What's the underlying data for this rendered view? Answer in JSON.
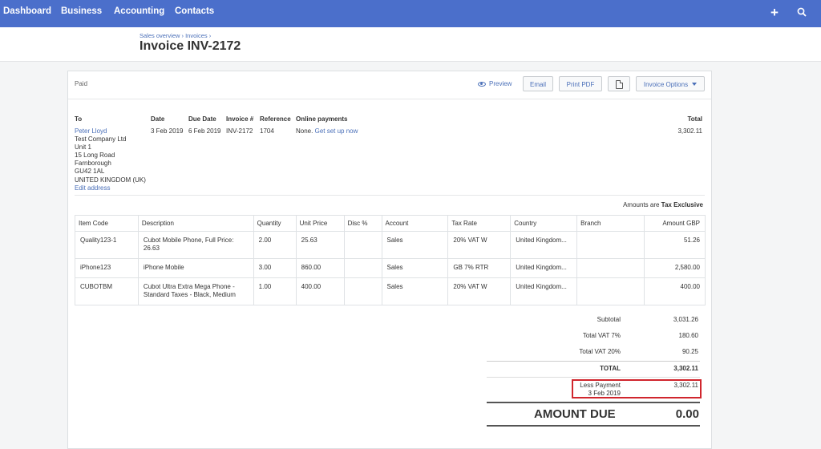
{
  "nav": {
    "items": [
      "Dashboard",
      "Business",
      "Accounting",
      "Contacts"
    ],
    "add_icon": "plus-icon",
    "search_icon": "search-icon"
  },
  "header": {
    "breadcrumb": "Sales overview › Invoices ›",
    "title": "Invoice INV-2172"
  },
  "toolbar": {
    "status": "Paid",
    "preview": "Preview",
    "email": "Email",
    "print_pdf": "Print PDF",
    "copy_icon": "copy-icon",
    "invoice_options": "Invoice Options"
  },
  "meta": {
    "to_label": "To",
    "date_label": "Date",
    "due_label": "Due Date",
    "invoice_label": "Invoice #",
    "reference_label": "Reference",
    "online_label": "Online payments",
    "total_label": "Total",
    "date": "3 Feb 2019",
    "due_date": "6 Feb 2019",
    "invoice_no": "INV-2172",
    "reference": "1704",
    "online_none": "None.",
    "online_link": "Get set up now",
    "total": "3,302.11"
  },
  "address": {
    "contact": "Peter Lloyd",
    "lines": [
      "Test Company Ltd",
      "Unit 1",
      "15 Long Road",
      "Farnborough",
      "GU42 1AL",
      "UNITED KINGDOM (UK)"
    ],
    "edit": "Edit address"
  },
  "amounts_note": {
    "prefix": "Amounts are",
    "value": "Tax Exclusive"
  },
  "table": {
    "columns": [
      "Item Code",
      "Description",
      "Quantity",
      "Unit Price",
      "Disc %",
      "Account",
      "Tax Rate",
      "Country",
      "Branch",
      "Amount GBP"
    ],
    "rows": [
      [
        "Quality123-1",
        "Cubot Mobile Phone, Full Price: 26.63",
        "2.00",
        "25.63",
        "",
        "Sales",
        "20% VAT W",
        "United Kingdom...",
        "",
        "51.26"
      ],
      [
        "iPhone123",
        "iPhone Mobile",
        "3.00",
        "860.00",
        "",
        "Sales",
        "GB 7% RTR",
        "United Kingdom...",
        "",
        "2,580.00"
      ],
      [
        "CUBOTBM",
        "Cubot Ultra Extra Mega Phone - Standard Taxes - Black, Medium",
        "1.00",
        "400.00",
        "",
        "Sales",
        "20% VAT W",
        "United Kingdom...",
        "",
        "400.00"
      ]
    ]
  },
  "totals": {
    "subtotal_label": "Subtotal",
    "subtotal": "3,031.26",
    "vat7_label": "Total VAT  7%",
    "vat7": "180.60",
    "vat20_label": "Total VAT  20%",
    "vat20": "90.25",
    "total_label": "TOTAL",
    "total": "3,302.11",
    "payment_label": "Less Payment",
    "payment_date": "3 Feb 2019",
    "payment": "3,302.11",
    "due_label": "AMOUNT DUE",
    "due": "0.00"
  }
}
